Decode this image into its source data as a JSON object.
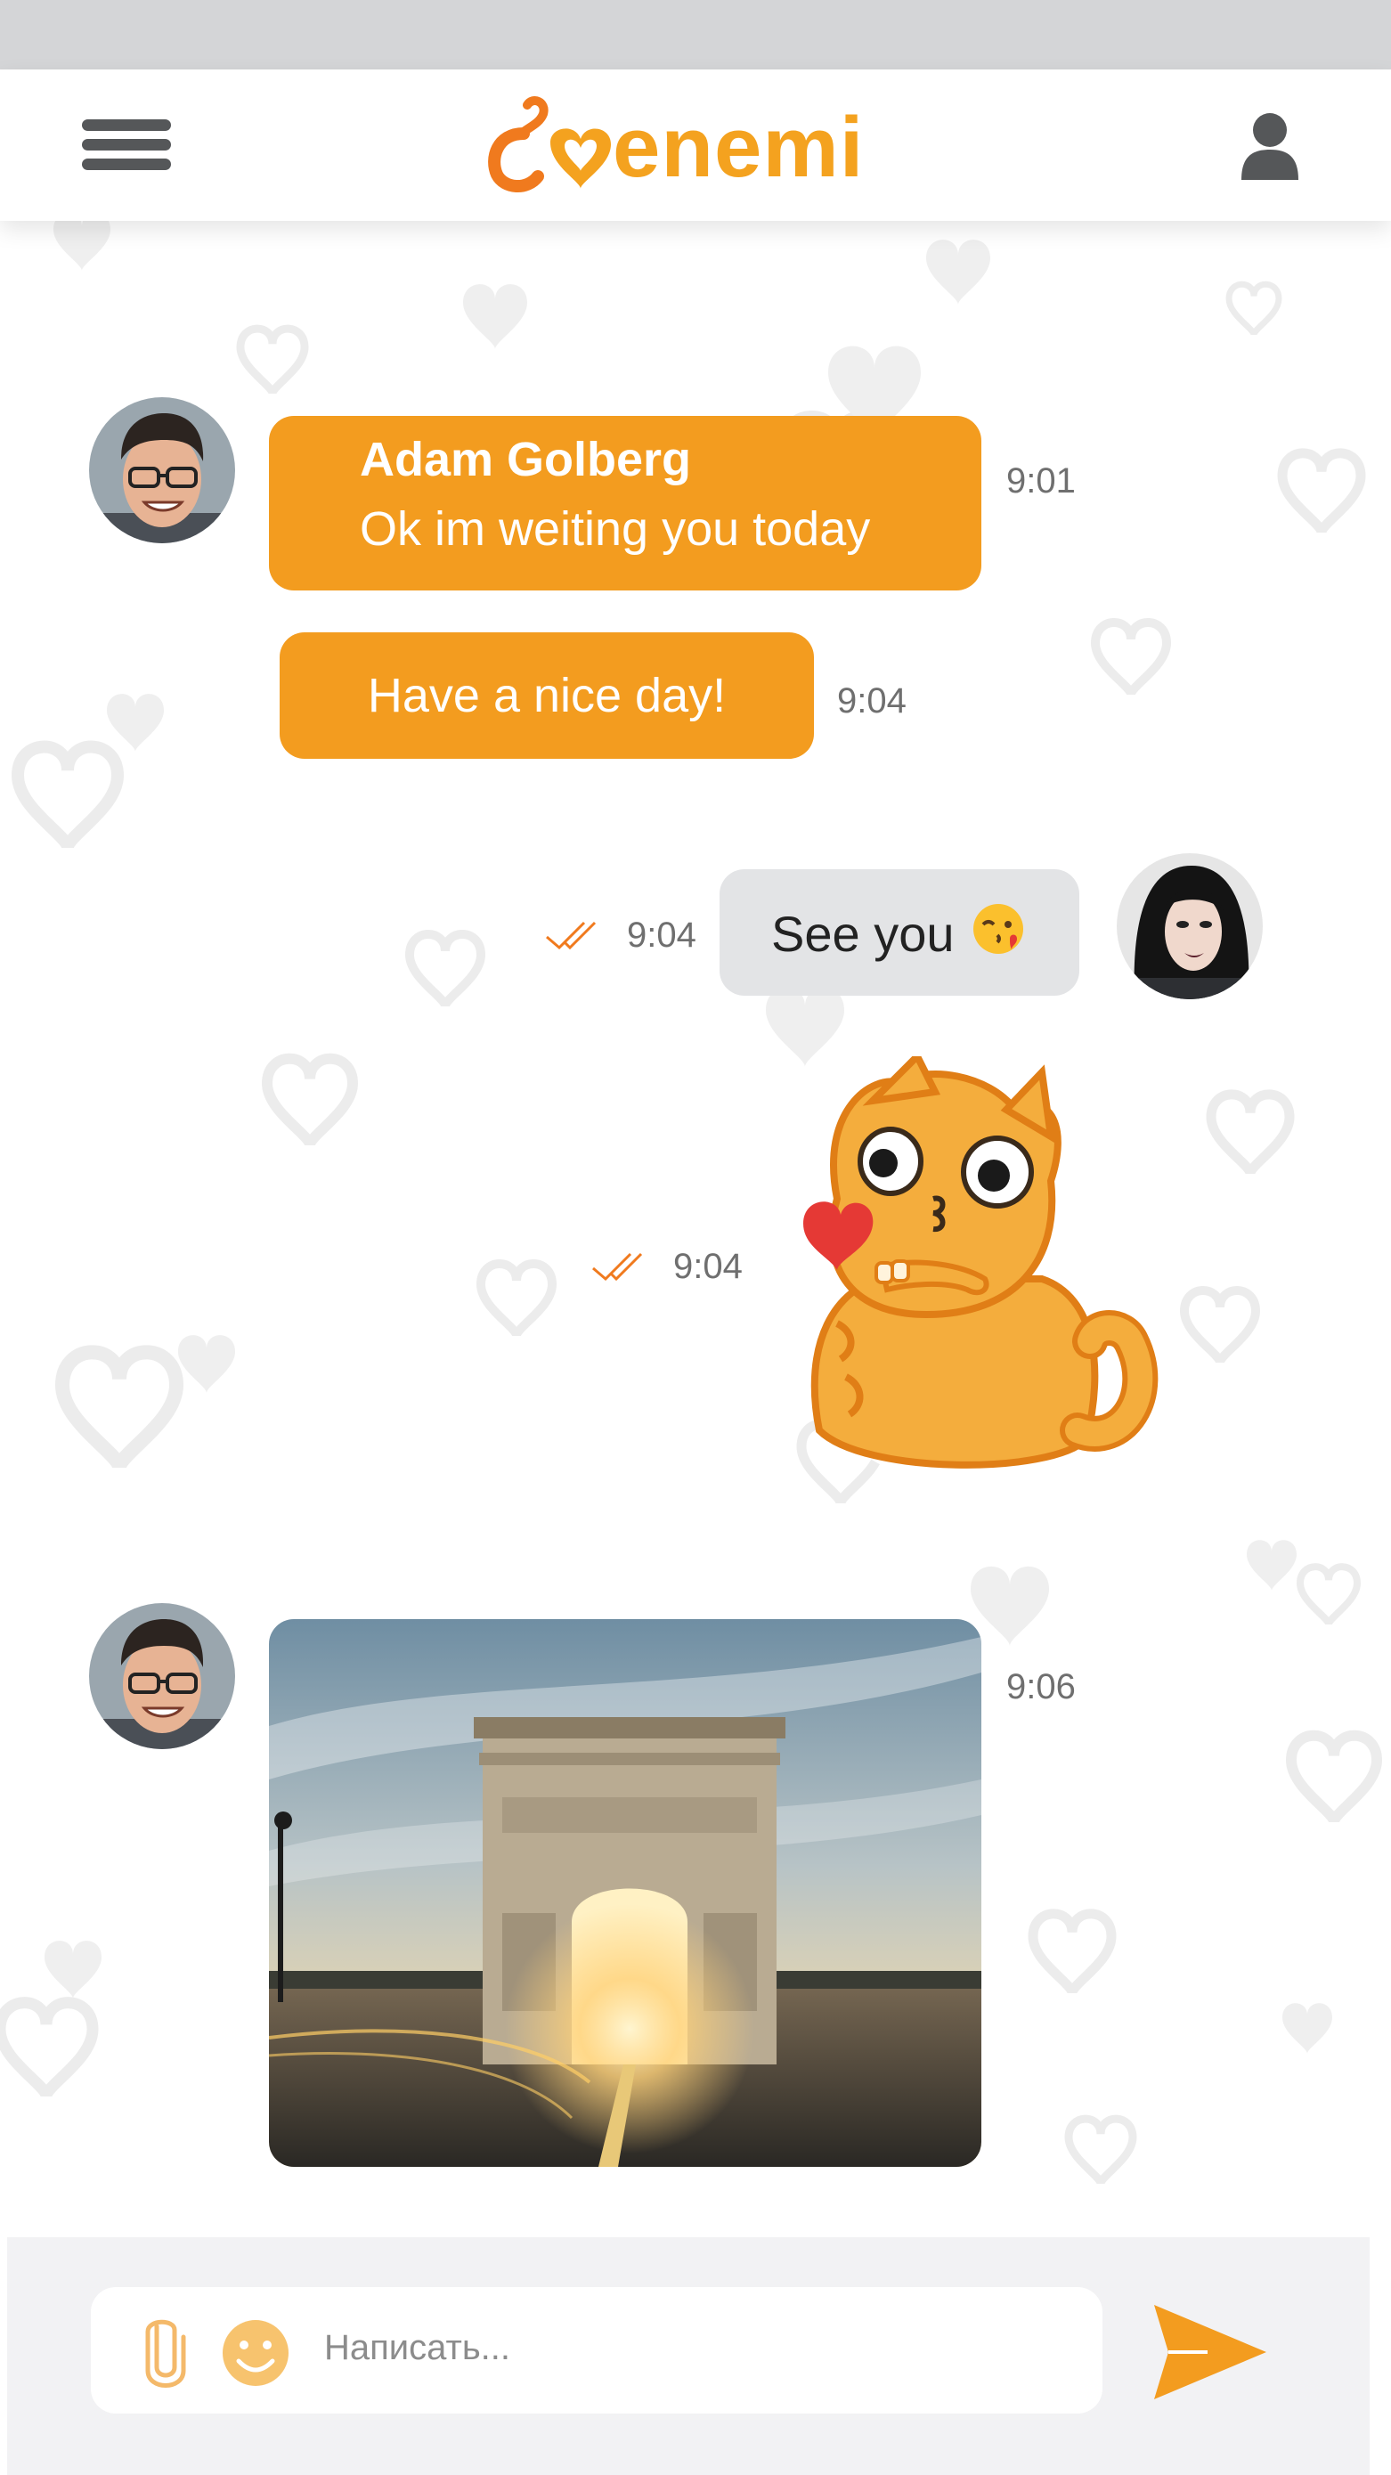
{
  "brand": {
    "name": "enemi",
    "accent": "#f39c1f",
    "dark": "#555759"
  },
  "header": {
    "menu_icon": "hamburger-menu-icon",
    "profile_icon": "user-icon"
  },
  "messages": [
    {
      "sender": "Adam Golberg",
      "text": "Ok im weiting you today",
      "time": "9:01",
      "side": "left"
    },
    {
      "text": "Have a nice day!",
      "time": "9:04",
      "side": "left"
    },
    {
      "text": "See you",
      "emoji": "😘",
      "time": "9:04",
      "side": "right",
      "status": "read"
    },
    {
      "type": "sticker",
      "sticker": "cat-kiss-sticker",
      "time": "9:04",
      "side": "right",
      "status": "read"
    },
    {
      "type": "photo",
      "photo": "arc-de-triomphe-photo",
      "time": "9:06",
      "side": "left"
    }
  ],
  "composer": {
    "placeholder": "Написать...",
    "attach_icon": "paperclip-icon",
    "emoji_icon": "smiley-icon",
    "send_icon": "send-arrow-icon"
  }
}
